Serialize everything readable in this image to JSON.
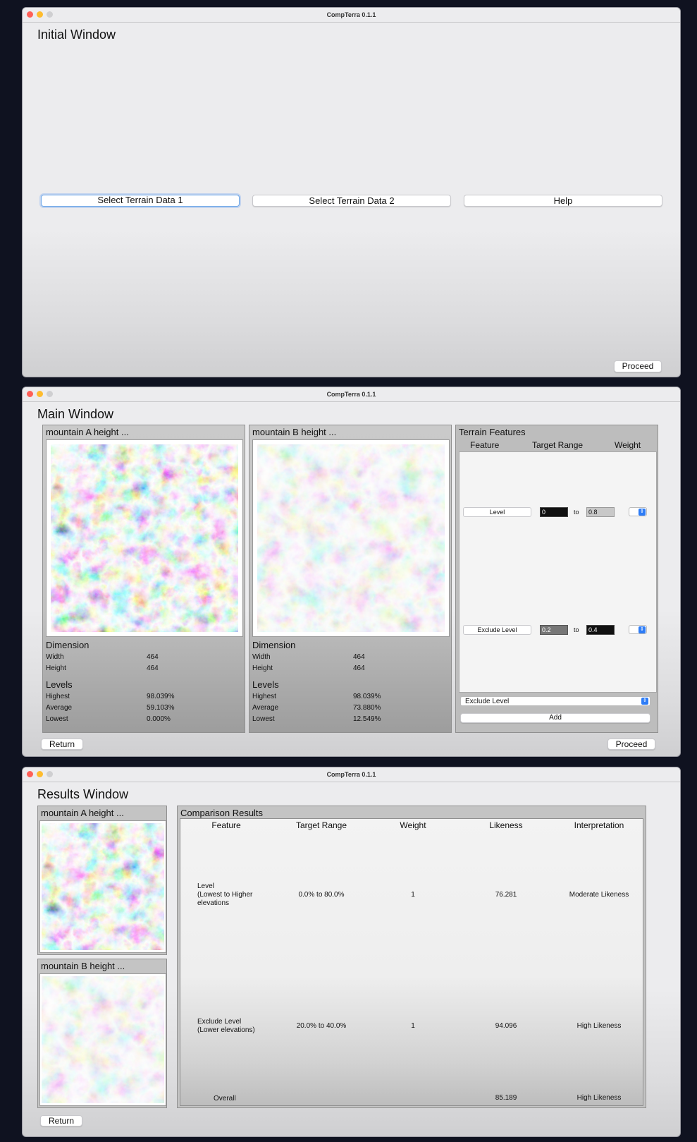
{
  "app_title": "CompTerra 0.1.1",
  "initial_window": {
    "heading": "Initial Window",
    "buttons": {
      "select1": "Select Terrain Data 1",
      "select2": "Select Terrain Data 2",
      "help": "Help",
      "proceed": "Proceed"
    }
  },
  "main_window": {
    "heading": "Main Window",
    "terrain_a": {
      "title": "mountain A height ...",
      "dimension_label": "Dimension",
      "width_label": "Width",
      "width": "464",
      "height_label": "Height",
      "height": "464",
      "levels_label": "Levels",
      "highest_label": "Highest",
      "highest": "98.039%",
      "average_label": "Average",
      "average": "59.103%",
      "lowest_label": "Lowest",
      "lowest": "0.000%"
    },
    "terrain_b": {
      "title": "mountain B height ...",
      "dimension_label": "Dimension",
      "width_label": "Width",
      "width": "464",
      "height_label": "Height",
      "height": "464",
      "levels_label": "Levels",
      "highest_label": "Highest",
      "highest": "98.039%",
      "average_label": "Average",
      "average": "73.880%",
      "lowest_label": "Lowest",
      "lowest": "12.549%"
    },
    "features": {
      "title": "Terrain Features",
      "col_feature": "Feature",
      "col_range": "Target Range",
      "col_weight": "Weight",
      "rows": [
        {
          "feature": "Level",
          "from": "0",
          "to_label": "to",
          "to": "0.8"
        },
        {
          "feature": "Exclude Level",
          "from": "0.2",
          "to_label": "to",
          "to": "0.4"
        }
      ],
      "select_value": "Exclude Level",
      "add_label": "Add"
    },
    "return_label": "Return",
    "proceed_label": "Proceed"
  },
  "results_window": {
    "heading": "Results Window",
    "terrain_a_title": "mountain A height ...",
    "terrain_b_title": "mountain B height ...",
    "comparison_title": "Comparison Results",
    "columns": [
      "Feature",
      "Target Range",
      "Weight",
      "Likeness",
      "Interpretation"
    ],
    "rows": [
      {
        "feature": "Level\n(Lowest to Higher\nelevations",
        "range": "0.0% to 80.0%",
        "weight": "1",
        "likeness": "76.281",
        "interpretation": "Moderate Likeness"
      },
      {
        "feature": "Exclude Level\n(Lower elevations)",
        "range": "20.0% to 40.0%",
        "weight": "1",
        "likeness": "94.096",
        "interpretation": "High Likeness"
      }
    ],
    "overall_label": "Overall",
    "overall_likeness": "85.189",
    "overall_interpretation": "High Likeness",
    "return_label": "Return"
  }
}
